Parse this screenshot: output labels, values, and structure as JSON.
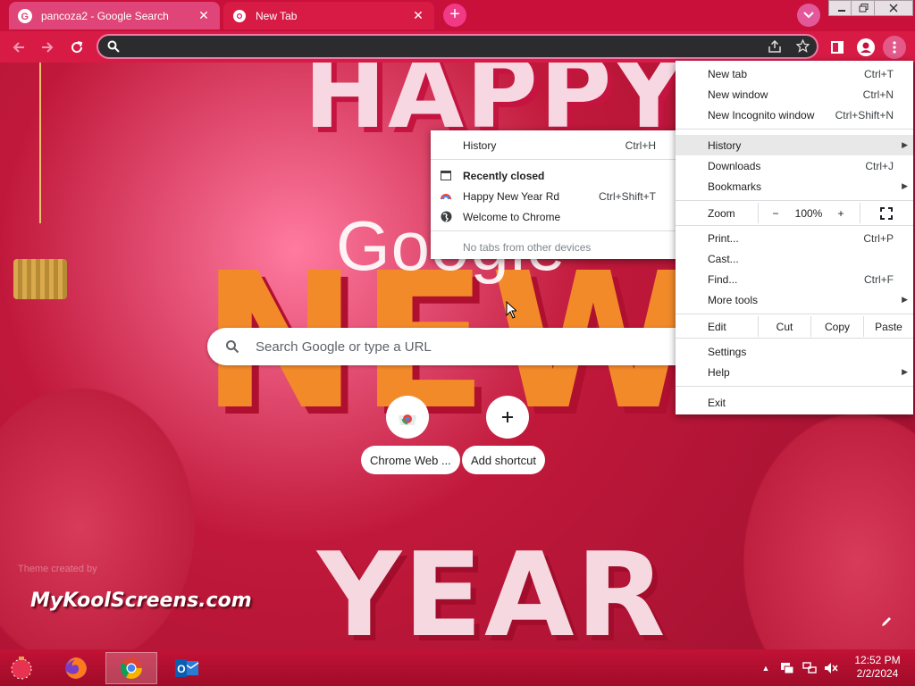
{
  "tabs": [
    {
      "title": "pancoza2 - Google Search",
      "icon": "google-g-icon"
    },
    {
      "title": "New Tab",
      "icon": "chrome-icon"
    }
  ],
  "omnibox": {
    "value": "",
    "placeholder": ""
  },
  "ntp": {
    "logo": "Google",
    "search_placeholder": "Search Google or type a URL",
    "shortcuts": [
      {
        "label": "Chrome Web ...",
        "icon": "chrome-web-store-icon"
      },
      {
        "label": "Add shortcut",
        "icon": "plus-icon"
      }
    ],
    "theme_credit": "Theme created by",
    "watermark": "MyKoolScreens.com"
  },
  "theme_art": {
    "word1": "HAPPY",
    "word2": "NEW",
    "word3": "YEAR"
  },
  "menu": {
    "new_tab": {
      "label": "New tab",
      "shortcut": "Ctrl+T"
    },
    "new_window": {
      "label": "New window",
      "shortcut": "Ctrl+N"
    },
    "new_incognito": {
      "label": "New Incognito window",
      "shortcut": "Ctrl+Shift+N"
    },
    "history": {
      "label": "History"
    },
    "downloads": {
      "label": "Downloads",
      "shortcut": "Ctrl+J"
    },
    "bookmarks": {
      "label": "Bookmarks"
    },
    "zoom": {
      "label": "Zoom",
      "minus": "−",
      "value": "100%",
      "plus": "+"
    },
    "print": {
      "label": "Print...",
      "shortcut": "Ctrl+P"
    },
    "cast": {
      "label": "Cast..."
    },
    "find": {
      "label": "Find...",
      "shortcut": "Ctrl+F"
    },
    "more_tools": {
      "label": "More tools"
    },
    "edit": {
      "label": "Edit",
      "cut": "Cut",
      "copy": "Copy",
      "paste": "Paste"
    },
    "settings": {
      "label": "Settings"
    },
    "help": {
      "label": "Help"
    },
    "exit": {
      "label": "Exit"
    }
  },
  "history_submenu": {
    "history": {
      "label": "History",
      "shortcut": "Ctrl+H"
    },
    "recently_closed": {
      "label": "Recently closed"
    },
    "items": [
      {
        "label": "Happy New Year Rd",
        "shortcut": "Ctrl+Shift+T",
        "icon": "rainbow-theme-icon"
      },
      {
        "label": "Welcome to Chrome",
        "shortcut": "",
        "icon": "globe-icon"
      }
    ],
    "other_devices": "No tabs from other devices"
  },
  "taskbar": {
    "apps": [
      {
        "name": "Firefox",
        "icon": "firefox-icon"
      },
      {
        "name": "Google Chrome",
        "icon": "chrome-icon"
      },
      {
        "name": "Outlook",
        "icon": "outlook-icon"
      }
    ],
    "time": "12:52 PM",
    "date": "2/2/2024"
  },
  "colors": {
    "tab_strip": "#c8103a",
    "toolbar": "#d81b45",
    "accent": "#f03a86"
  }
}
